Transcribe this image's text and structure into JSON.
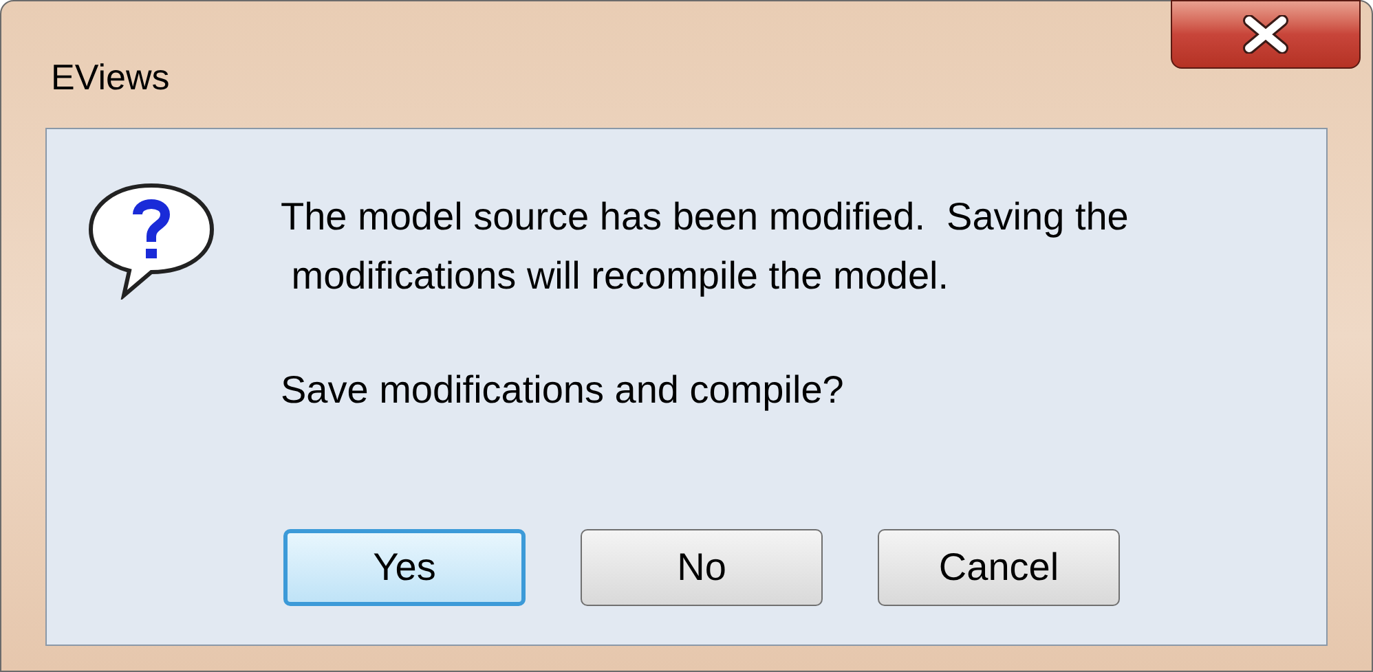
{
  "window": {
    "title": "EViews"
  },
  "message": {
    "lines": [
      "The model source has been modified.  Saving the",
      " modifications will recompile the model."
    ],
    "question": "Save modifications and compile?"
  },
  "buttons": [
    {
      "label": "Yes",
      "default": true
    },
    {
      "label": "No",
      "default": false
    },
    {
      "label": "Cancel",
      "default": false
    }
  ]
}
